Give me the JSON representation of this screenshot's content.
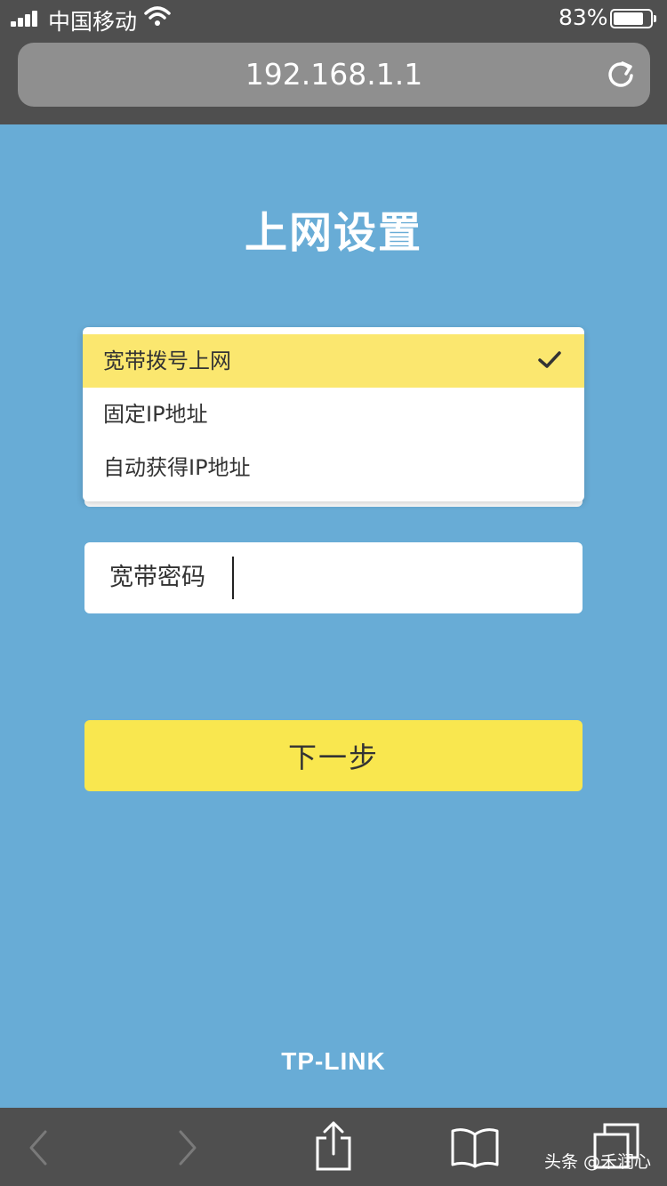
{
  "status_bar": {
    "carrier": "中国移动",
    "battery_percent": "83%",
    "battery_level": 0.83
  },
  "browser": {
    "url": "192.168.1.1"
  },
  "page": {
    "title": "上网设置",
    "connection_type_options": [
      {
        "label": "宽带拨号上网",
        "selected": true
      },
      {
        "label": "固定IP地址",
        "selected": false
      },
      {
        "label": "自动获得IP地址",
        "selected": false
      }
    ],
    "password_label": "宽带密码",
    "password_value": "",
    "next_button": "下一步",
    "brand": "TP-LINK"
  },
  "colors": {
    "background": "#68acd6",
    "chrome": "#4f4f4f",
    "selected_option": "#fbe76f",
    "button": "#f9e74f"
  },
  "watermark": "头条 @禾润心"
}
